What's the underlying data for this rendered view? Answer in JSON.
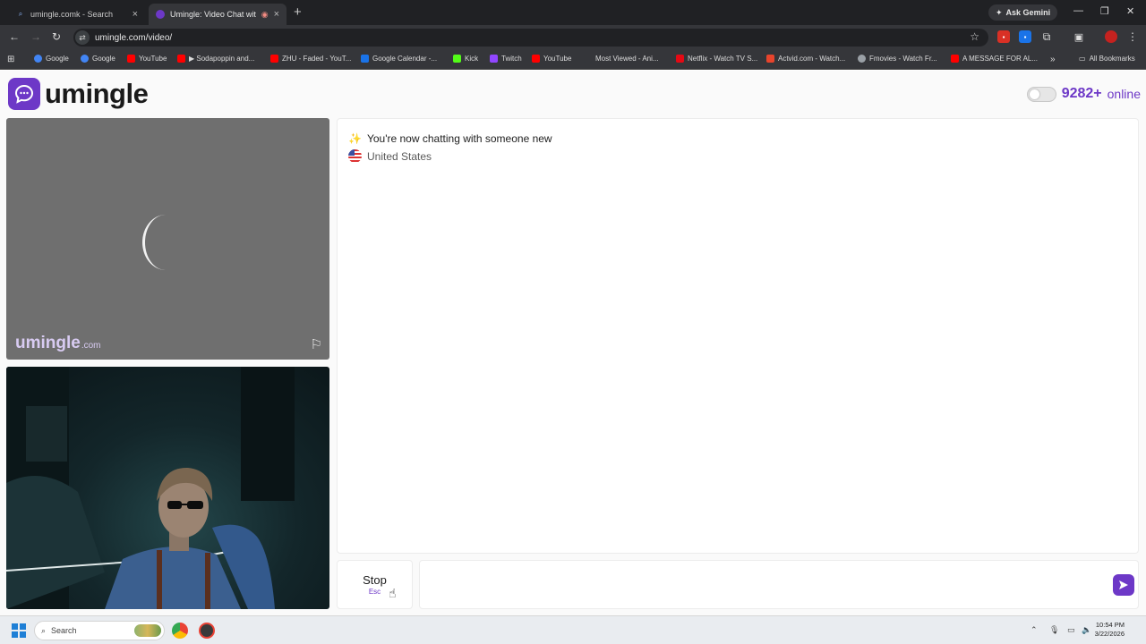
{
  "browser": {
    "tabs": [
      {
        "title": "umingle.comk - Search",
        "active": false
      },
      {
        "title": "Umingle: Video Chat with S",
        "active": true
      }
    ],
    "ask_gemini": "Ask Gemini",
    "url": "umingle.com/video/",
    "bookmarks": [
      {
        "label": "Google",
        "color": "#4285f4"
      },
      {
        "label": "Google",
        "color": "#4285f4"
      },
      {
        "label": "YouTube",
        "color": "#ff0000"
      },
      {
        "label": "▶ Sodapoppin and...",
        "color": "#ff0000"
      },
      {
        "label": "ZHU - Faded - YouT...",
        "color": "#ff0000"
      },
      {
        "label": "Google Calendar -...",
        "color": "#1a73e8"
      },
      {
        "label": "Kick",
        "color": "#53fc18"
      },
      {
        "label": "Twitch",
        "color": "#9146ff"
      },
      {
        "label": "YouTube",
        "color": "#ff0000"
      },
      {
        "label": "Most Viewed - Ani...",
        "color": "#35363a"
      },
      {
        "label": "Netflix - Watch TV S...",
        "color": "#e50914"
      },
      {
        "label": "Actvid.com - Watch...",
        "color": "#e8442c"
      },
      {
        "label": "Fmovies - Watch Fr...",
        "color": "#9aa0a6"
      },
      {
        "label": "A MESSAGE FOR AL...",
        "color": "#ff0000"
      }
    ],
    "all_bookmarks": "All Bookmarks"
  },
  "header": {
    "logo_text": "umingle",
    "online_count": "9282+",
    "online_label": "online"
  },
  "stranger_video": {
    "watermark": "umingle",
    "watermark_suffix": ".com"
  },
  "chat": {
    "status_message": "You're now chatting with someone new",
    "country": "United States"
  },
  "controls": {
    "stop_label": "Stop",
    "stop_hint": "Esc",
    "message_placeholder": ""
  },
  "taskbar": {
    "search_label": "Search",
    "time": "10:54 PM",
    "date": "3/22/2026"
  },
  "colors": {
    "brand": "#6d38c7",
    "browser_dark": "#202124",
    "video_bg": "#6f6f6f"
  }
}
